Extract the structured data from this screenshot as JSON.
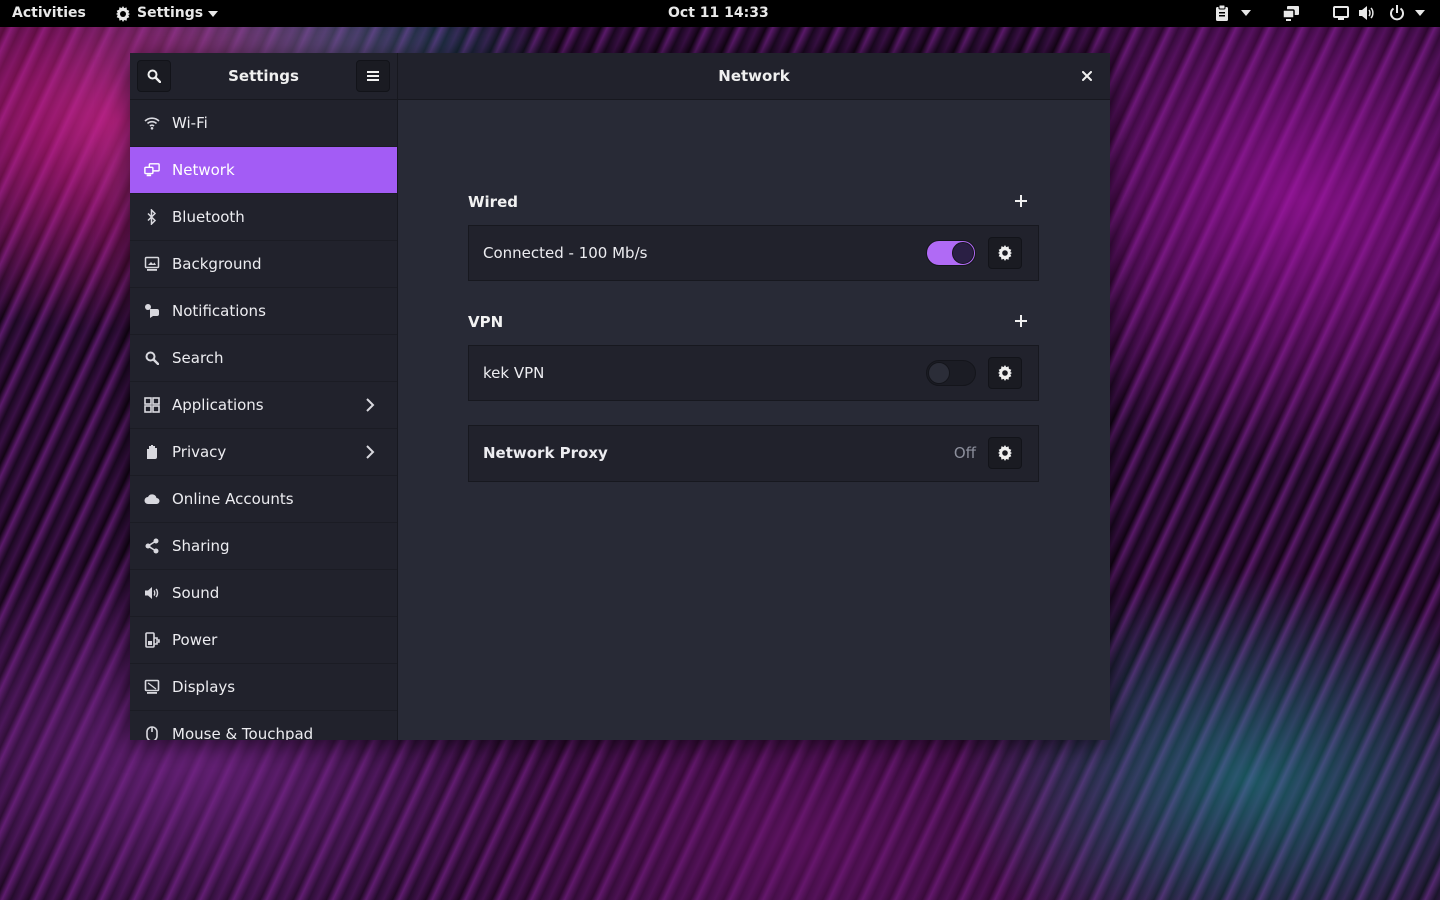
{
  "topbar": {
    "activities": "Activities",
    "app_menu": "Settings",
    "clock": "Oct 11  14:33"
  },
  "window": {
    "sidebar_title": "Settings",
    "content_title": "Network"
  },
  "sidebar": {
    "items": [
      {
        "label": "Wi-Fi",
        "icon": "wifi-icon"
      },
      {
        "label": "Network",
        "icon": "network-icon",
        "active": true
      },
      {
        "label": "Bluetooth",
        "icon": "bluetooth-icon"
      },
      {
        "label": "Background",
        "icon": "background-icon"
      },
      {
        "label": "Notifications",
        "icon": "notifications-icon"
      },
      {
        "label": "Search",
        "icon": "search-icon"
      },
      {
        "label": "Applications",
        "icon": "applications-icon",
        "submenu": true
      },
      {
        "label": "Privacy",
        "icon": "hand-icon",
        "submenu": true
      },
      {
        "label": "Online Accounts",
        "icon": "cloud-icon"
      },
      {
        "label": "Sharing",
        "icon": "share-icon"
      },
      {
        "label": "Sound",
        "icon": "speaker-icon"
      },
      {
        "label": "Power",
        "icon": "power-plug-icon"
      },
      {
        "label": "Displays",
        "icon": "display-icon"
      },
      {
        "label": "Mouse & Touchpad",
        "icon": "mouse-icon"
      }
    ]
  },
  "network": {
    "wired": {
      "title": "Wired",
      "status": "Connected - 100 Mb/s",
      "enabled": true
    },
    "vpn": {
      "title": "VPN",
      "name": "kek VPN",
      "enabled": false
    },
    "proxy": {
      "title": "Network Proxy",
      "value": "Off"
    }
  },
  "colors": {
    "accent": "#a35cf5",
    "window_bg": "#282a36",
    "sidebar_bg": "#21222c"
  }
}
